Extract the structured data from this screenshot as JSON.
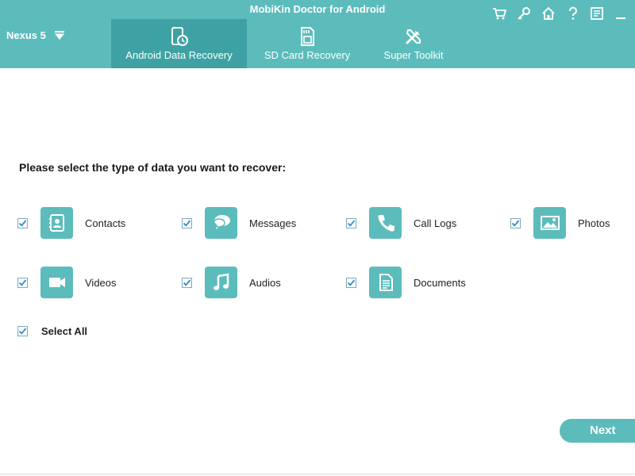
{
  "app": {
    "title": "MobiKin Doctor for Android"
  },
  "device": {
    "name": "Nexus 5"
  },
  "tabs": [
    {
      "label": "Android Data Recovery",
      "icon": "phone-recovery-icon",
      "active": true
    },
    {
      "label": "SD Card Recovery",
      "icon": "sd-card-icon",
      "active": false
    },
    {
      "label": "Super Toolkit",
      "icon": "tools-icon",
      "active": false
    }
  ],
  "toolbar": [
    "cart-icon",
    "key-icon",
    "home-icon",
    "help-icon",
    "feedback-icon",
    "minimize-icon",
    "close-icon"
  ],
  "main": {
    "prompt": "Please select the type of data you want to recover:",
    "options": [
      {
        "label": "Contacts",
        "icon": "contacts-icon",
        "checked": true
      },
      {
        "label": "Messages",
        "icon": "messages-icon",
        "checked": true
      },
      {
        "label": "Call Logs",
        "icon": "call-logs-icon",
        "checked": true
      },
      {
        "label": "Photos",
        "icon": "photos-icon",
        "checked": true
      },
      {
        "label": "Videos",
        "icon": "videos-icon",
        "checked": true
      },
      {
        "label": "Audios",
        "icon": "audios-icon",
        "checked": true
      },
      {
        "label": "Documents",
        "icon": "documents-icon",
        "checked": true
      }
    ],
    "select_all": {
      "label": "Select All",
      "checked": true
    },
    "next_label": "Next"
  },
  "colors": {
    "accent": "#5cbcbc",
    "active_tab": "#3ea2a4",
    "checkmark": "#2a8fc4"
  }
}
